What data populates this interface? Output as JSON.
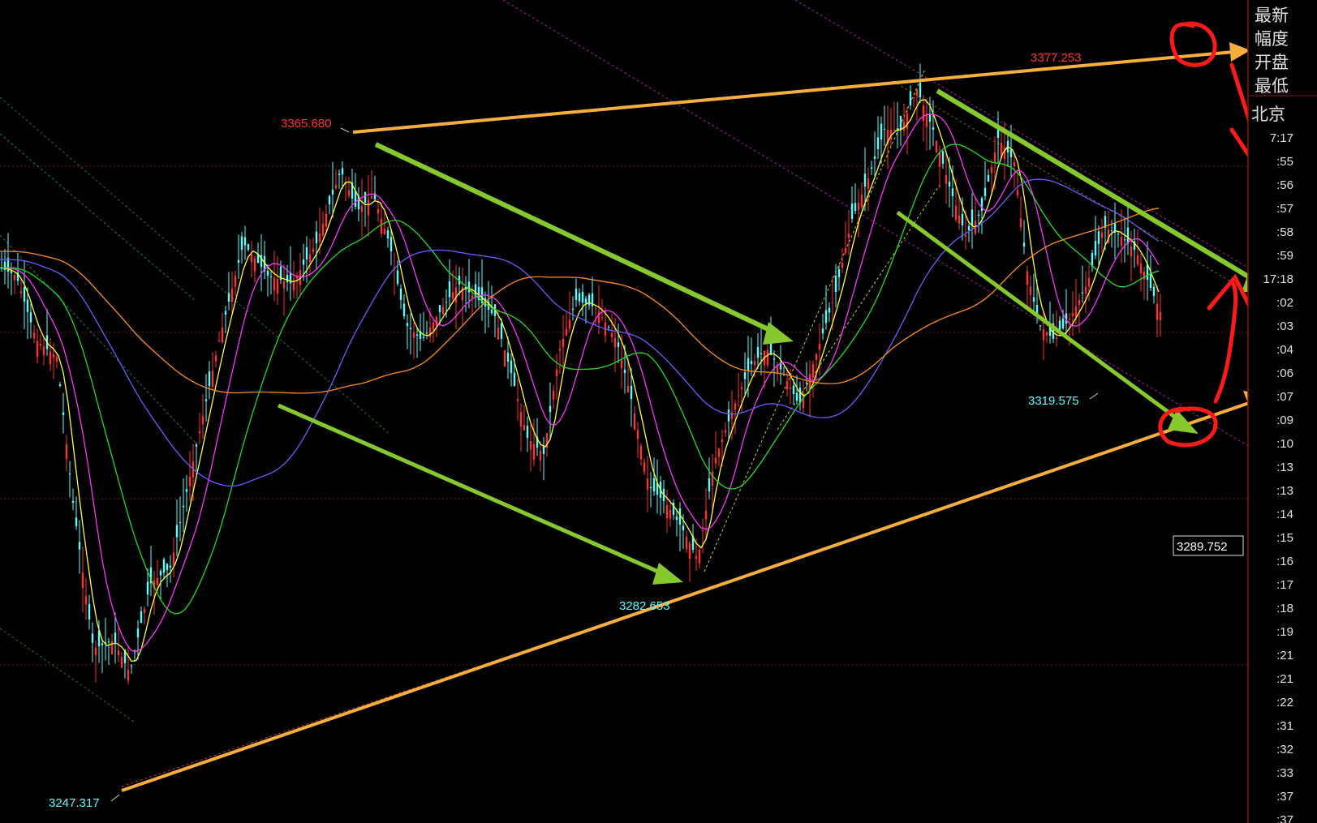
{
  "chart_data": {
    "type": "candlestick",
    "title": "",
    "ylim": [
      3240,
      3385
    ],
    "annotations": {
      "high_right": "3377.253",
      "high_left": "3365.680",
      "low_mid": "3282.653",
      "low_left": "3247.317",
      "low_right": "3319.575",
      "current_price": "3289.752"
    },
    "colors": {
      "up": "#ff3333",
      "down": "#54ffff",
      "ma_yellow": "#ffff33",
      "ma_magenta": "#ff33ff",
      "ma_green": "#22dd22",
      "ma_blue": "#6a5cff",
      "ma_orange": "#ff8c1a",
      "trend_orange": "#f7ae3c",
      "arrow_green": "#86c92c",
      "marker_red": "#ff1a1a"
    }
  },
  "side_panel": {
    "labels": [
      "最新",
      "幅度",
      "开盘",
      "最低"
    ],
    "region_label": "北京",
    "times": [
      "7:17",
      ":55",
      ":56",
      ":57",
      ":58",
      ":59",
      "17:18",
      ":02",
      ":03",
      ":04",
      ":06",
      ":07",
      ":09",
      ":10",
      ":13",
      ":13",
      ":14",
      ":15",
      ":16",
      ":17",
      ":18",
      ":19",
      ":21",
      ":21",
      ":22",
      ":31",
      ":32",
      ":33",
      ":37",
      ":37"
    ]
  }
}
